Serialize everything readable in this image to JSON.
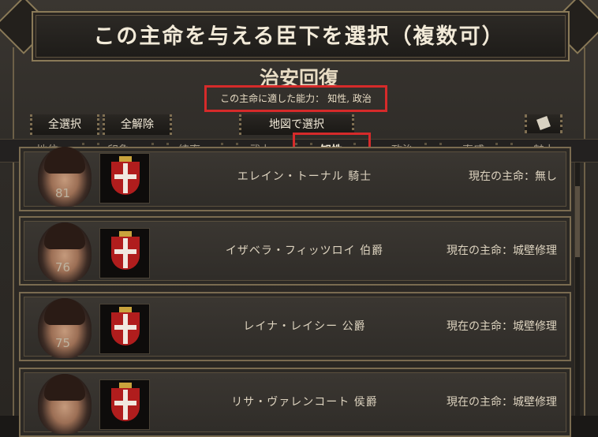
{
  "dialog": {
    "title": "この主命を与える臣下を選択（複数可）",
    "task_name": "治安回復",
    "suitable_label": "この主命に適した能力：",
    "suitable_abilities": "知性, 政治"
  },
  "buttons": {
    "select_all": "全選択",
    "deselect_all": "全解除",
    "select_on_map": "地図で選択"
  },
  "sort_tabs": [
    {
      "label": "地位"
    },
    {
      "label": "印象"
    },
    {
      "label": "統率"
    },
    {
      "label": "武力"
    },
    {
      "label": "知性"
    },
    {
      "label": "政治"
    },
    {
      "label": "直感"
    },
    {
      "label": "魅力"
    }
  ],
  "active_sort": "知性",
  "vassals": [
    {
      "level": "81",
      "name": "エレイン・トーナル 騎士",
      "task": "現在の主命：無し"
    },
    {
      "level": "76",
      "name": "イザベラ・フィッツロイ 伯爵",
      "task": "現在の主命：城壁修理"
    },
    {
      "level": "75",
      "name": "レイナ・レイシー 公爵",
      "task": "現在の主命：城壁修理"
    },
    {
      "level": "",
      "name": "リサ・ヴァレンコート 侯爵",
      "task": "現在の主命：城壁修理"
    }
  ],
  "colors": {
    "highlight_border": "#d62a2a",
    "frame_gold": "#8a7a58",
    "crest_red": "#b01d1d"
  }
}
